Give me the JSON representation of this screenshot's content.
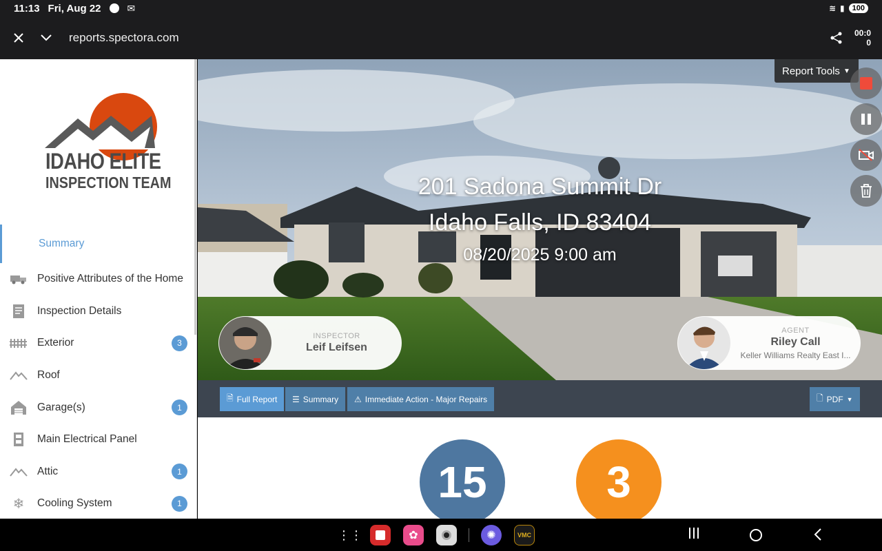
{
  "status": {
    "time": "11:13",
    "date": "Fri, Aug 22",
    "battery": "100"
  },
  "browser": {
    "url": "reports.spectora.com",
    "timer": "00:0\n0"
  },
  "logo": {
    "line1": "IDAHO ELITE",
    "line2": "INSPECTION TEAM"
  },
  "sidebar": {
    "items": [
      {
        "label": "Summary",
        "icon": "summary",
        "badge": ""
      },
      {
        "label": "Positive Attributes of the Home",
        "icon": "truck-icon",
        "badge": ""
      },
      {
        "label": "Inspection Details",
        "icon": "document-icon",
        "badge": ""
      },
      {
        "label": "Exterior",
        "icon": "fence-icon",
        "badge": "3"
      },
      {
        "label": "Roof",
        "icon": "roof-icon",
        "badge": ""
      },
      {
        "label": "Garage(s)",
        "icon": "house-icon",
        "badge": "1"
      },
      {
        "label": "Main Electrical Panel",
        "icon": "panel-icon",
        "badge": ""
      },
      {
        "label": "Attic",
        "icon": "attic-icon",
        "badge": "1"
      },
      {
        "label": "Cooling System",
        "icon": "snowflake-icon",
        "badge": "1"
      }
    ]
  },
  "hero": {
    "address_line1": "201 Sadona Summit Dr",
    "address_line2": "Idaho Falls, ID 83404",
    "datetime": "08/20/2025 9:00 am",
    "inspector": {
      "role": "INSPECTOR",
      "name": "Leif Leifsen"
    },
    "agent": {
      "role": "AGENT",
      "name": "Riley Call",
      "company": "Keller Williams Realty East I..."
    }
  },
  "report_tools": {
    "label": "Report Tools"
  },
  "toolbar": {
    "full_report": "Full Report",
    "summary": "Summary",
    "immediate": "Immediate Action - Major Repairs",
    "pdf": "PDF"
  },
  "summary_counts": {
    "first": "15",
    "second": "3"
  },
  "colors": {
    "accent": "#5b9bd5",
    "blue_circle": "#4e77a0",
    "orange_circle": "#f5901e",
    "toolbar": "#3d4550",
    "logo_sun": "#d9480f"
  }
}
